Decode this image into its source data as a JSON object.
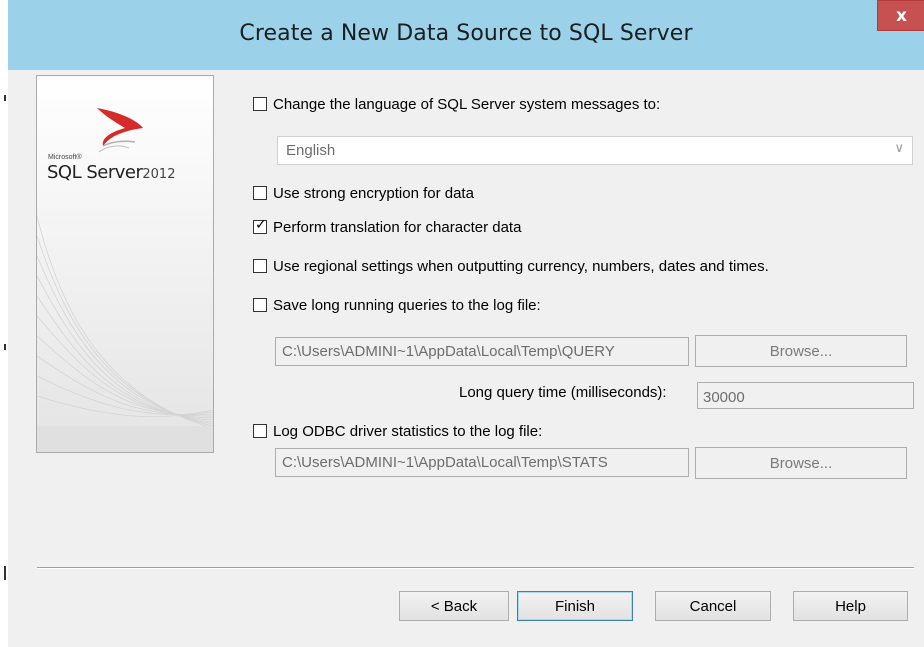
{
  "window": {
    "title": "Create a New Data Source to SQL Server",
    "close_label": "x"
  },
  "logo": {
    "microsoft": "Microsoft®",
    "product": "SQL Server",
    "version": "2012"
  },
  "options": {
    "change_language": {
      "label": "Change the language of SQL Server system messages to:",
      "checked": false
    },
    "language_value": "English",
    "strong_encryption": {
      "label": "Use strong encryption for data",
      "checked": false
    },
    "translation": {
      "label": "Perform translation for character data",
      "checked": true
    },
    "regional": {
      "label": "Use regional settings when outputting currency, numbers, dates and times.",
      "checked": false
    },
    "long_queries": {
      "label": "Save long running queries to the log file:",
      "checked": false
    },
    "long_queries_path": "C:\\Users\\ADMINI~1\\AppData\\Local\\Temp\\QUERY",
    "long_queries_browse": "Browse...",
    "long_query_time_label": "Long query time (milliseconds):",
    "long_query_time_value": "30000",
    "odbc_stats": {
      "label": "Log ODBC driver statistics to the log file:",
      "checked": false
    },
    "odbc_stats_path": "C:\\Users\\ADMINI~1\\AppData\\Local\\Temp\\STATS",
    "odbc_stats_browse": "Browse..."
  },
  "buttons": {
    "back": "< Back",
    "finish": "Finish",
    "cancel": "Cancel",
    "help": "Help"
  },
  "colors": {
    "titlebar": "#9bd2ea",
    "close": "#c75050",
    "dialog_bg": "#f0f0f0",
    "logo_red": "#d42b2b"
  }
}
